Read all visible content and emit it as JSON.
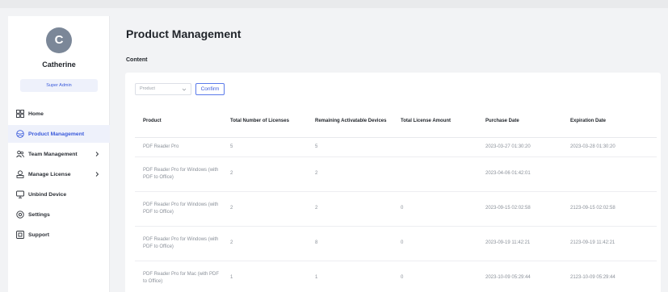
{
  "sidebar": {
    "user": {
      "avatar_letter": "C",
      "name": "Catherine",
      "role": "Super Admin"
    },
    "items": [
      {
        "label": "Home",
        "icon": "grid-icon",
        "active": false,
        "has_submenu": false
      },
      {
        "label": "Product Management",
        "icon": "globe-icon",
        "active": true,
        "has_submenu": false
      },
      {
        "label": "Team Management",
        "icon": "team-icon",
        "active": false,
        "has_submenu": true
      },
      {
        "label": "Manage License",
        "icon": "key-icon",
        "active": false,
        "has_submenu": true
      },
      {
        "label": "Unbind Device",
        "icon": "monitor-icon",
        "active": false,
        "has_submenu": false
      },
      {
        "label": "Settings",
        "icon": "gear-icon",
        "active": false,
        "has_submenu": false
      },
      {
        "label": "Support",
        "icon": "support-icon",
        "active": false,
        "has_submenu": false
      }
    ]
  },
  "main": {
    "title": "Product Management",
    "section_label": "Content",
    "filter": {
      "placeholder": "Product",
      "confirm_label": "Confirm"
    },
    "table": {
      "headers": [
        "Product",
        "Total Number of Licenses",
        "Remaining Activatable Devices",
        "Total License Amount",
        "Purchase Date",
        "Expiration Date"
      ],
      "rows": [
        [
          "PDF Reader Pro",
          "5",
          "5",
          "",
          "2023-03-27 01:30:20",
          "2023-03-28 01:30:20"
        ],
        [
          "PDF Reader Pro for Windows (with PDF to Office)",
          "2",
          "2",
          "",
          "2023-04-06 01:42:01",
          ""
        ],
        [
          "PDF Reader Pro for Windows (with PDF to Office)",
          "2",
          "2",
          "0",
          "2023-09-15 02:02:58",
          "2123-09-15 02:02:58"
        ],
        [
          "PDF Reader Pro for Windows (with PDF to Office)",
          "2",
          "8",
          "0",
          "2023-09-19 11:42:21",
          "2123-09-19 11:42:21"
        ],
        [
          "PDF Reader Pro for Mac (with PDF to Office)",
          "1",
          "1",
          "0",
          "2023-10-09 05:29:44",
          "2123-10-09 05:29:44"
        ]
      ]
    }
  },
  "colors": {
    "accent": "#3b5bdb",
    "active_bg": "#eef1fb",
    "avatar_bg": "#7b8798"
  }
}
